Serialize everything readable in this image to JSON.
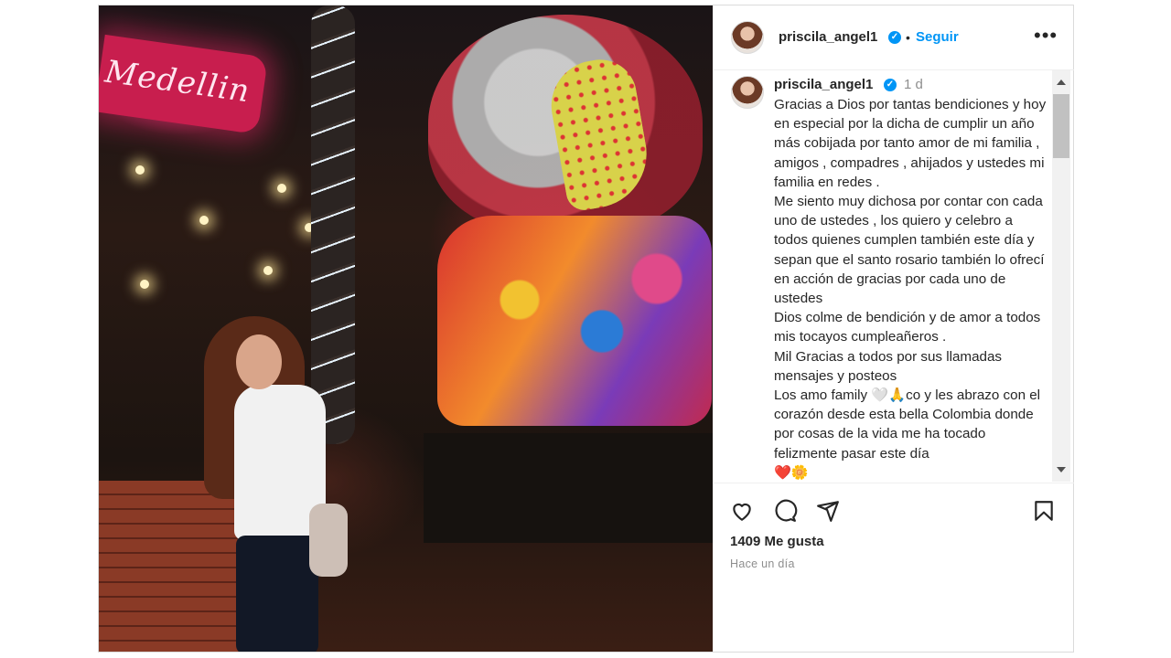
{
  "post": {
    "photo": {
      "sign_text": "Medellin",
      "alt": "photo"
    },
    "header": {
      "username": "priscila_angel1",
      "verified_icon": "verified-badge-icon",
      "separator": "•",
      "follow_label": "Seguir",
      "more_icon": "•••"
    },
    "comment": {
      "username": "priscila_angel1",
      "time": "1 d",
      "caption": "Gracias a Dios por tantas bendiciones y hoy en especial por la dicha de cumplir un año más cobijada por tanto amor de mi familia , amigos , compadres , ahijados y ustedes mi familia en redes .\nMe siento muy dichosa por contar con cada uno de ustedes , los quiero y celebro a todos quienes cumplen también este día y sepan que el santo rosario también lo ofrecí en acción de gracias por cada uno de ustedes\nDios colme de bendición y de amor a todos mis tocayos cumpleañeros .\nMil Gracias a todos por sus llamadas mensajes y posteos\nLos amo family 🤍🙏co y les abrazo con el corazón desde esta bella Colombia donde por cosas de la vida me ha tocado felizmente pasar este día\n❤️🌼"
    },
    "actions": {
      "like_icon": "heart-icon",
      "comment_icon": "comment-icon",
      "share_icon": "share-icon",
      "save_icon": "bookmark-icon"
    },
    "likes_label": "1409 Me gusta",
    "posted_label": "Hace un día"
  },
  "colors": {
    "accent": "#0095f6",
    "text": "#262626",
    "muted": "#8e8e8e",
    "border": "#dbdbdb"
  }
}
